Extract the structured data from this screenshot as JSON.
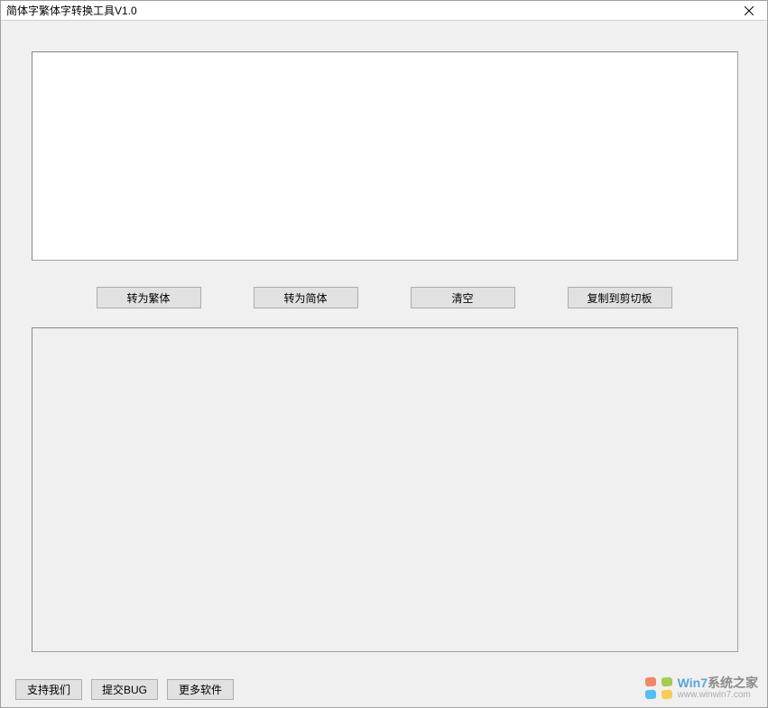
{
  "window": {
    "title": "简体字繁体字转换工具V1.0"
  },
  "input": {
    "value": "",
    "placeholder": ""
  },
  "buttons": {
    "to_traditional": "转为繁体",
    "to_simplified": "转为简体",
    "clear": "清空",
    "copy": "复制到剪切板"
  },
  "output": {
    "value": ""
  },
  "bottom": {
    "support": "支持我们",
    "submit_bug": "提交BUG",
    "more_software": "更多软件"
  },
  "watermark": {
    "line1_prefix": "Win7",
    "line1_suffix": "系统之家",
    "line2": "www.winwin7.com"
  }
}
